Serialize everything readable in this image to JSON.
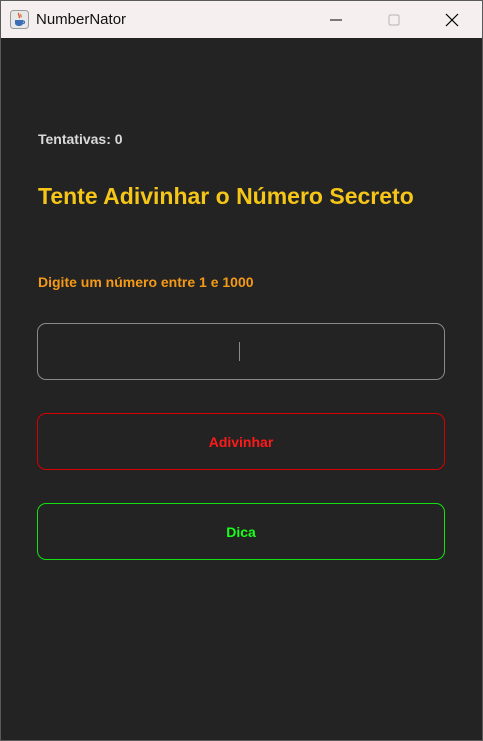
{
  "window": {
    "title": "NumberNator"
  },
  "game": {
    "attempts_label": "Tentativas: 0",
    "headline": "Tente Adivinhar o Número Secreto",
    "prompt": "Digite um número entre 1 e 1000",
    "input_value": ""
  },
  "buttons": {
    "guess_label": "Adivinhar",
    "hint_label": "Dica"
  },
  "colors": {
    "background": "#232323",
    "headline": "#f5c518",
    "prompt": "#f59a17",
    "guess": "#ff1a1a",
    "hint": "#1aff1a"
  },
  "icons": {
    "app": "java-cup-icon",
    "minimize": "minimize-icon",
    "maximize": "maximize-icon",
    "close": "close-icon"
  }
}
